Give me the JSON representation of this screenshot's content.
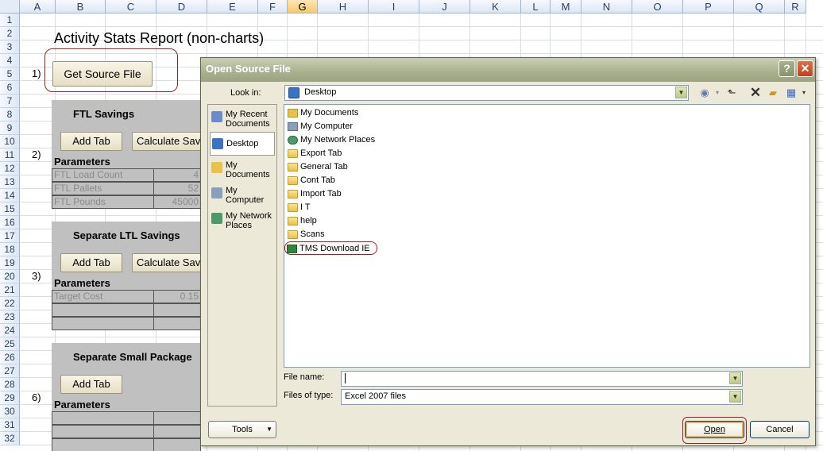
{
  "spreadsheet": {
    "columns": [
      "A",
      "B",
      "C",
      "D",
      "E",
      "F",
      "G",
      "H",
      "I",
      "J",
      "K",
      "L",
      "M",
      "N",
      "O",
      "P",
      "Q",
      "R"
    ],
    "selected_column": "G",
    "rows": [
      "1",
      "2",
      "3",
      "4",
      "5",
      "6",
      "7",
      "8",
      "9",
      "10",
      "11",
      "12",
      "13",
      "14",
      "15",
      "16",
      "17",
      "18",
      "19",
      "20",
      "21",
      "22",
      "23",
      "24",
      "25",
      "26",
      "27",
      "28",
      "29",
      "30",
      "31",
      "32"
    ],
    "title": "Activity Stats Report (non-charts)",
    "steps": {
      "s1": "1)",
      "s2": "2)",
      "s3": "3)",
      "s6": "6)"
    },
    "get_source_file_label": "Get Source File",
    "sections": {
      "ftl": {
        "heading": "FTL Savings",
        "add_tab": "Add Tab",
        "calculate": "Calculate Sav",
        "parameters": "Parameters",
        "rows": [
          {
            "label": "FTL Load Count",
            "value": "4"
          },
          {
            "label": "FTL Pallets",
            "value": "52"
          },
          {
            "label": "FTL Pounds",
            "value": "45000"
          }
        ]
      },
      "ltl": {
        "heading": "Separate LTL Savings",
        "add_tab": "Add Tab",
        "calculate": "Calculate Sav",
        "parameters": "Parameters",
        "rows": [
          {
            "label": "Target Cost",
            "value": "0.15"
          }
        ]
      },
      "small": {
        "heading": "Separate Small Package",
        "add_tab": "Add Tab",
        "parameters": "Parameters"
      }
    }
  },
  "dialog": {
    "title": "Open Source File",
    "help": "?",
    "close": "✕",
    "look_in_label": "Look in:",
    "look_in_value": "Desktop",
    "places": [
      {
        "label": "My Recent Documents",
        "icon": "recent-documents-icon"
      },
      {
        "label": "Desktop",
        "icon": "desktop-icon"
      },
      {
        "label": "My Documents",
        "icon": "my-documents-icon"
      },
      {
        "label": "My Computer",
        "icon": "my-computer-icon"
      },
      {
        "label": "My Network Places",
        "icon": "network-places-icon"
      }
    ],
    "files": [
      {
        "name": "My Documents",
        "icon": "my-documents-icon"
      },
      {
        "name": "My Computer",
        "icon": "my-computer-icon"
      },
      {
        "name": "My Network Places",
        "icon": "network-places-icon"
      },
      {
        "name": "Export Tab",
        "icon": "folder-icon"
      },
      {
        "name": "General Tab",
        "icon": "folder-icon"
      },
      {
        "name": "Cont Tab",
        "icon": "folder-icon"
      },
      {
        "name": "Import Tab",
        "icon": "folder-icon"
      },
      {
        "name": "I T",
        "icon": "folder-icon"
      },
      {
        "name": "help",
        "icon": "folder-icon"
      },
      {
        "name": "Scans",
        "icon": "folder-shortcut-icon"
      },
      {
        "name": "TMS Download IE",
        "icon": "excel-file-icon"
      }
    ],
    "file_name_label": "File name:",
    "file_name_value": "",
    "files_of_type_label": "Files of type:",
    "files_of_type_value": "Excel 2007 files",
    "tools_label": "Tools",
    "open_label": "Open",
    "cancel_label": "Cancel"
  }
}
